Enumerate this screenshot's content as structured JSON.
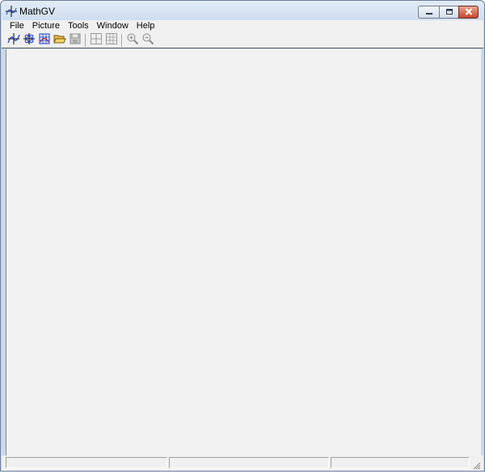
{
  "window": {
    "title": "MathGV"
  },
  "menubar": {
    "items": [
      {
        "label": "File"
      },
      {
        "label": "Picture"
      },
      {
        "label": "Tools"
      },
      {
        "label": "Window"
      },
      {
        "label": "Help"
      }
    ]
  },
  "toolbar": {
    "buttons": [
      {
        "icon": "function-graph-icon",
        "enabled": true
      },
      {
        "icon": "parametric-graph-icon",
        "enabled": true
      },
      {
        "icon": "3d-graph-icon",
        "enabled": true
      },
      {
        "icon": "open-folder-icon",
        "enabled": true
      },
      {
        "icon": "save-icon",
        "enabled": false
      },
      {
        "icon": "grid-icon",
        "enabled": false
      },
      {
        "icon": "grid-labels-icon",
        "enabled": false
      },
      {
        "icon": "zoom-in-icon",
        "enabled": false
      },
      {
        "icon": "zoom-out-icon",
        "enabled": false
      }
    ]
  },
  "statusbar": {
    "panes": [
      "",
      "",
      ""
    ]
  },
  "colors": {
    "titlebar": "#d6e3f3",
    "close_button": "#c6452b",
    "client_background": "#f2f2f2",
    "chrome": "#f0f0f0"
  }
}
